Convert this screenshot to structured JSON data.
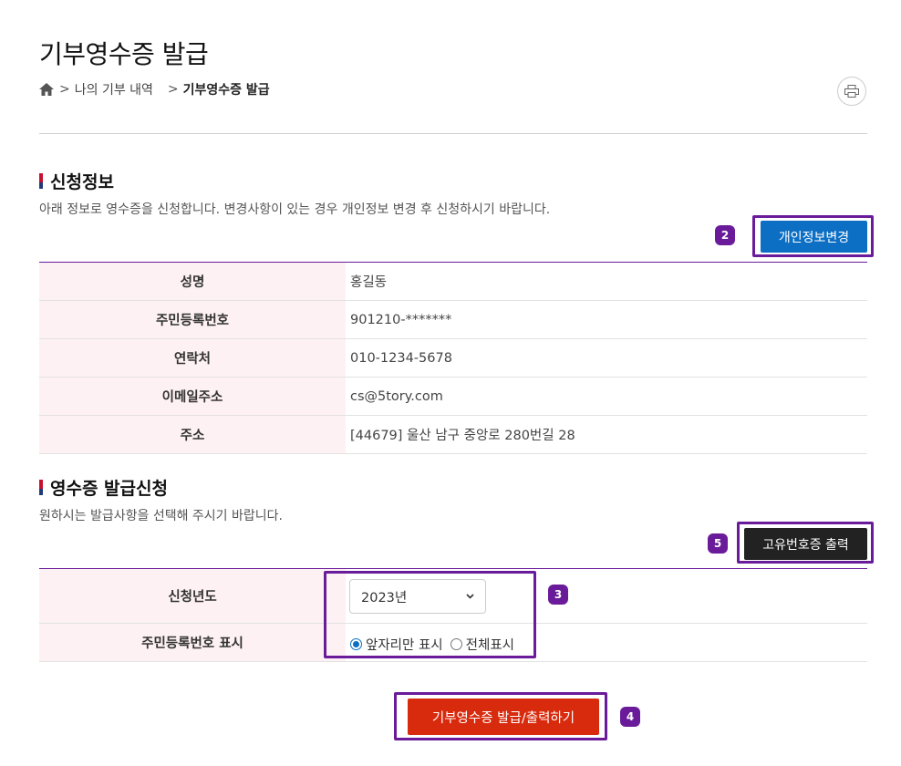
{
  "header": {
    "title": "기부영수증 발급",
    "breadcrumb": [
      "나의 기부 내역",
      "기부영수증 발급"
    ]
  },
  "section1": {
    "title": "신청정보",
    "desc": "아래 정보로 영수증을 신청합니다. 변경사항이 있는 경우 개인정보 변경 후 신청하시기 바랍니다.",
    "button_label": "개인정보변경",
    "badge": "2",
    "rows": [
      {
        "label": "성명",
        "value": "홍길동"
      },
      {
        "label": "주민등록번호",
        "value": "901210-*******"
      },
      {
        "label": "연락처",
        "value": "010-1234-5678"
      },
      {
        "label": "이메일주소",
        "value": "cs@5tory.com"
      },
      {
        "label": "주소",
        "value": "[44679] 울산 남구 중앙로 280번길 28"
      }
    ]
  },
  "section2": {
    "title": "영수증 발급신청",
    "desc": "원하시는 발급사항을 선택해 주시기 바랍니다.",
    "button_label": "고유번호증 출력",
    "badge": "5",
    "year_label": "신청년도",
    "year_value": "2023년",
    "id_label": "주민등록번호 표시",
    "radio_options": [
      "앞자리만 표시",
      "전체표시"
    ],
    "radio_selected": 0,
    "badge_select": "3"
  },
  "submit": {
    "label": "기부영수증 발급/출력하기",
    "badge": "4"
  },
  "colors": {
    "accent_purple": "#6a1b9a",
    "button_blue": "#0c6fc4",
    "button_red": "#d82a0d",
    "row_header_bg": "#fdf1f3"
  }
}
